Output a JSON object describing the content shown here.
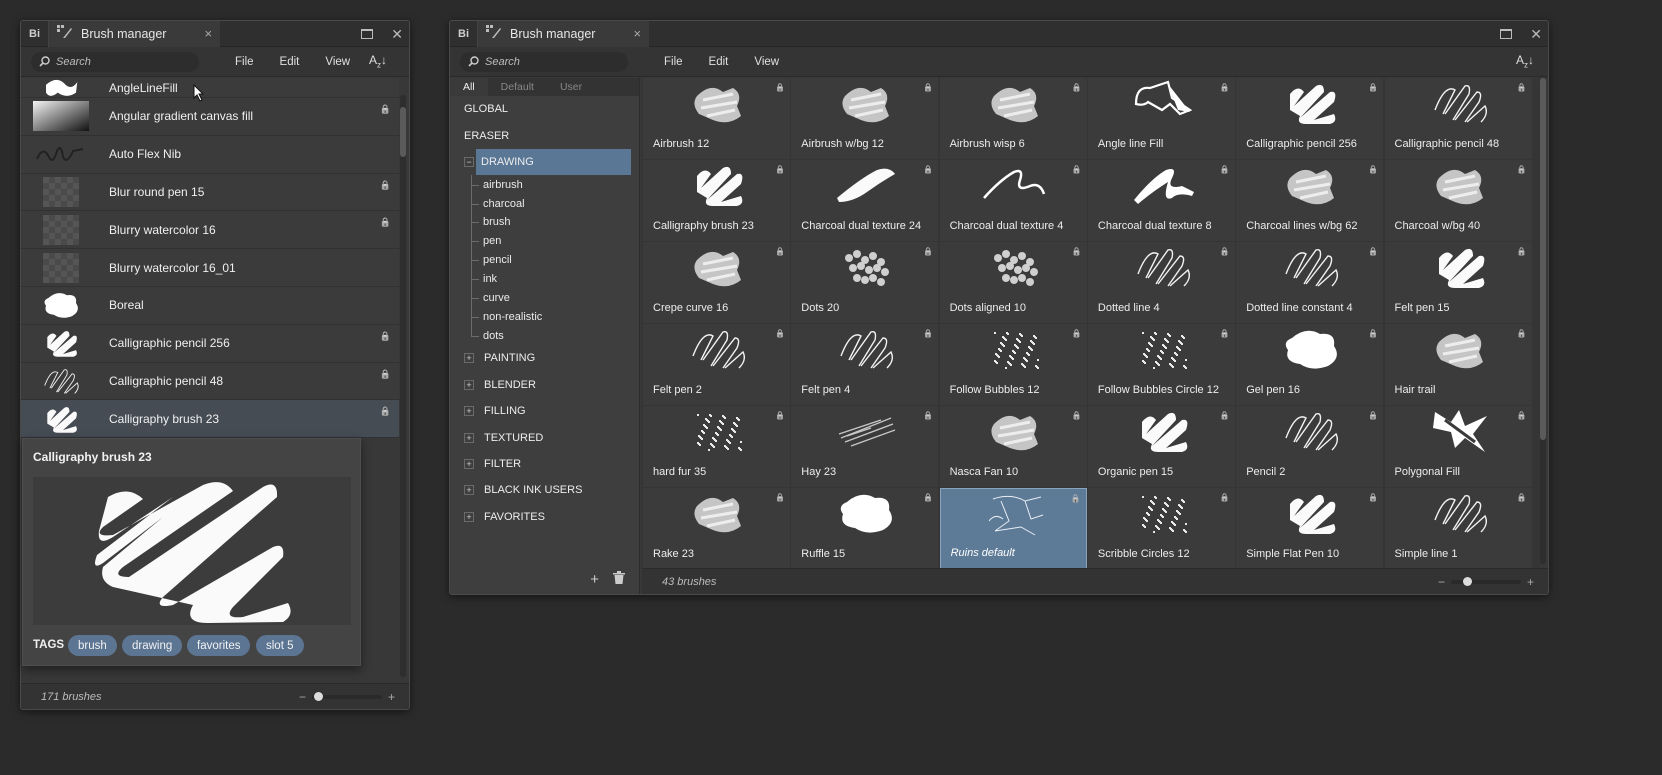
{
  "left_window": {
    "title": "Brush manager",
    "app_badge": "Bi",
    "search_placeholder": "Search",
    "menu": [
      "File",
      "Edit",
      "View"
    ],
    "sort_label": "A",
    "sort_sub": "z",
    "items": [
      {
        "label": "AngleLineFill",
        "locked": false,
        "thumb": "squiggle"
      },
      {
        "label": "Angular gradient canvas fill",
        "locked": true,
        "thumb": "gradient"
      },
      {
        "label": "Auto Flex Nib",
        "locked": false,
        "thumb": "script"
      },
      {
        "label": "Blur round pen 15",
        "locked": true,
        "thumb": "checker"
      },
      {
        "label": "Blurry watercolor 16",
        "locked": true,
        "thumb": "checker"
      },
      {
        "label": "Blurry watercolor 16_01",
        "locked": false,
        "thumb": "checker"
      },
      {
        "label": "Boreal",
        "locked": false,
        "thumb": "blob"
      },
      {
        "label": "Calligraphic pencil 256",
        "locked": true,
        "thumb": "scribble"
      },
      {
        "label": "Calligraphic pencil 48",
        "locked": true,
        "thumb": "lines"
      },
      {
        "label": "Calligraphy brush 23",
        "locked": true,
        "thumb": "scribble",
        "selected": true
      }
    ],
    "popup": {
      "title": "Calligraphy brush 23",
      "tags_label": "TAGS",
      "tags": [
        "brush",
        "drawing",
        "favorites",
        "slot 5"
      ]
    },
    "count": "171 brushes"
  },
  "right_window": {
    "title": "Brush manager",
    "app_badge": "Bi",
    "search_placeholder": "Search",
    "menu": [
      "File",
      "Edit",
      "View"
    ],
    "sort_label": "A",
    "sort_sub": "z",
    "filter_tabs": [
      "All",
      "Default",
      "User"
    ],
    "categories_top": [
      "GLOBAL",
      "ERASER"
    ],
    "drawing": "DRAWING",
    "subcategories": [
      "airbrush",
      "charcoal",
      "brush",
      "pen",
      "pencil",
      "ink",
      "curve",
      "non-realistic",
      "dots"
    ],
    "categories_bottom": [
      "PAINTING",
      "BLENDER",
      "FILLING",
      "TEXTURED",
      "FILTER",
      "BLACK INK USERS",
      "FAVORITES"
    ],
    "brushes": [
      {
        "label": "Airbrush 12",
        "thumb": "soft"
      },
      {
        "label": "Airbrush w/bg 12",
        "thumb": "soft"
      },
      {
        "label": "Airbrush wisp 6",
        "thumb": "soft"
      },
      {
        "label": "Angle line Fill",
        "thumb": "angle"
      },
      {
        "label": "Calligraphic pencil 256",
        "thumb": "scribble"
      },
      {
        "label": "Calligraphic pencil 48",
        "thumb": "lines"
      },
      {
        "label": "Calligraphy brush 23",
        "thumb": "scribble"
      },
      {
        "label": "Charcoal dual texture 24",
        "thumb": "stroke"
      },
      {
        "label": "Charcoal dual texture 4",
        "thumb": "thinwave"
      },
      {
        "label": "Charcoal dual texture 8",
        "thumb": "wave"
      },
      {
        "label": "Charcoal lines w/bg 62",
        "thumb": "soft"
      },
      {
        "label": "Charcoal w/bg 40",
        "thumb": "soft"
      },
      {
        "label": "Crepe curve 16",
        "thumb": "soft"
      },
      {
        "label": "Dots 20",
        "thumb": "dots"
      },
      {
        "label": "Dots aligned 10",
        "thumb": "dots"
      },
      {
        "label": "Dotted line 4",
        "thumb": "lines"
      },
      {
        "label": "Dotted line constant 4",
        "thumb": "lines"
      },
      {
        "label": "Felt pen 15",
        "thumb": "scribble"
      },
      {
        "label": "Felt pen 2",
        "thumb": "lines"
      },
      {
        "label": "Felt pen 4",
        "thumb": "lines"
      },
      {
        "label": "Follow Bubbles 12",
        "thumb": "noise"
      },
      {
        "label": "Follow Bubbles Circle 12",
        "thumb": "noise"
      },
      {
        "label": "Gel pen 16",
        "thumb": "blob"
      },
      {
        "label": "Hair trail",
        "thumb": "soft"
      },
      {
        "label": "hard fur 35",
        "thumb": "noise"
      },
      {
        "label": "Hay 23",
        "thumb": "hay"
      },
      {
        "label": "Nasca Fan 10",
        "thumb": "soft"
      },
      {
        "label": "Organic pen 15",
        "thumb": "scribble"
      },
      {
        "label": "Pencil 2",
        "thumb": "lines"
      },
      {
        "label": "Polygonal Fill",
        "thumb": "poly"
      },
      {
        "label": "Rake 23",
        "thumb": "soft"
      },
      {
        "label": "Ruffle 15",
        "thumb": "blob"
      },
      {
        "label": "Ruins default",
        "thumb": "ruins",
        "selected": true
      },
      {
        "label": "Scribble Circles 12",
        "thumb": "noise"
      },
      {
        "label": "Simple Flat Pen 10",
        "thumb": "scribble"
      },
      {
        "label": "Simple line 1",
        "thumb": "lines"
      }
    ],
    "count": "43 brushes"
  },
  "colors": {
    "selection": "#5a7896",
    "tag": "#5b7593",
    "background": "#2b2b2b"
  }
}
